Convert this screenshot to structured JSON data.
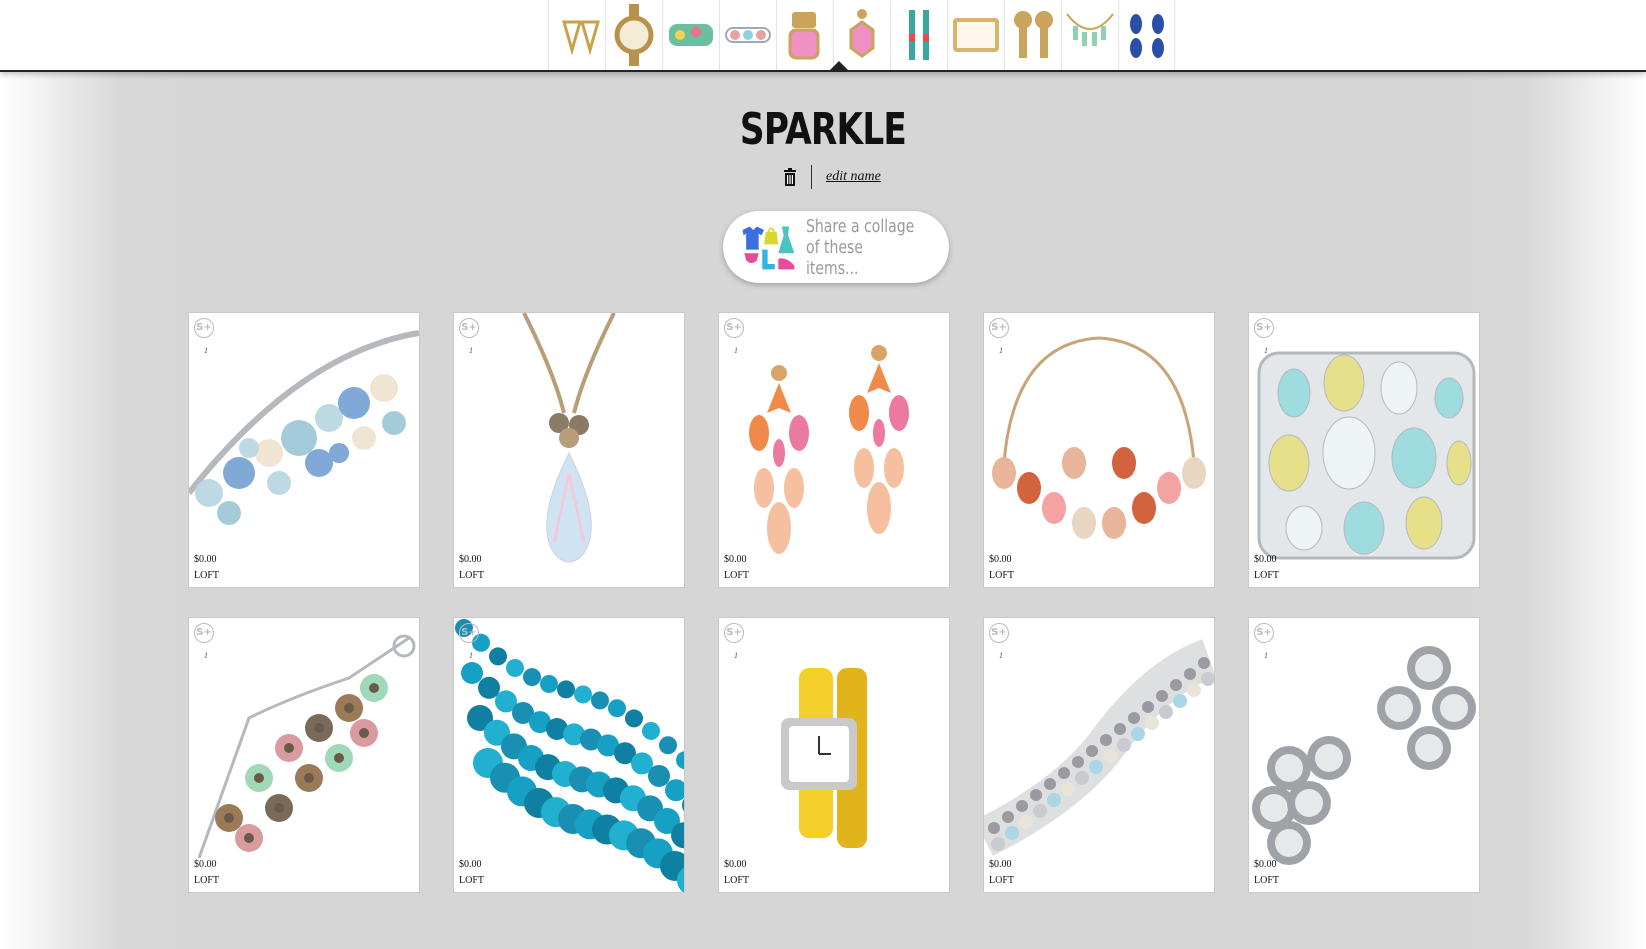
{
  "header": {
    "thumbnails": [
      {
        "name": "triangle-earrings-thumb",
        "color": "#c7a24a"
      },
      {
        "name": "gold-watch-thumb",
        "color": "#b8924a"
      },
      {
        "name": "multicolor-bracelet-thumb",
        "color": "#6bbf9f"
      },
      {
        "name": "pastel-bracelet-thumb",
        "color": "#e8a0a0"
      },
      {
        "name": "pink-stone-earrings-thumb",
        "color": "#ef8fc4"
      },
      {
        "name": "pink-octagon-earring-thumb",
        "color": "#ef8fc4"
      },
      {
        "name": "drop-earrings-thumb",
        "color": "#3aa7a1"
      },
      {
        "name": "gold-cuff-thumb",
        "color": "#d8b46a"
      },
      {
        "name": "gold-clip-earrings-thumb",
        "color": "#c9a45a"
      },
      {
        "name": "mint-necklace-thumb",
        "color": "#8fd1b0"
      },
      {
        "name": "blue-drop-earrings-thumb",
        "color": "#2b4fa8"
      }
    ]
  },
  "board": {
    "title": "SPARKLE",
    "edit_label": "edit name"
  },
  "collage": {
    "line1": "Share a collage",
    "line2": "of these items..."
  },
  "items": [
    {
      "badge": "S+",
      "count": "1",
      "price": "$0.00",
      "brand": "LOFT",
      "kind": "cluster-bracelet",
      "colors": [
        "#b9d7e3",
        "#7aa4d6",
        "#efe4d0",
        "#9fc9d6"
      ]
    },
    {
      "badge": "S+",
      "count": "1",
      "price": "$0.00",
      "brand": "LOFT",
      "kind": "pendant-necklace",
      "colors": [
        "#b89e78",
        "#8a7a66",
        "#cfe4f2",
        "#f3c9d9"
      ]
    },
    {
      "badge": "S+",
      "count": "1",
      "price": "$0.00",
      "brand": "LOFT",
      "kind": "statement-earrings",
      "colors": [
        "#f08a4b",
        "#ec7aa0",
        "#f6c0a0",
        "#d9a46a"
      ]
    },
    {
      "badge": "S+",
      "count": "1",
      "price": "$0.00",
      "brand": "LOFT",
      "kind": "bib-necklace",
      "colors": [
        "#e8b49a",
        "#d3633f",
        "#f4a2a2",
        "#e8d6c2"
      ]
    },
    {
      "badge": "S+",
      "count": "1",
      "price": "$0.00",
      "brand": "LOFT",
      "kind": "stone-cuff",
      "colors": [
        "#9fdcdf",
        "#e6e08a",
        "#eef4f6",
        "#cfe9ee"
      ]
    },
    {
      "badge": "S+",
      "count": "1",
      "price": "$0.00",
      "brand": "LOFT",
      "kind": "flower-bracelet",
      "colors": [
        "#9b7a58",
        "#9fd9b8",
        "#d99aa0",
        "#7a6a5a"
      ]
    },
    {
      "badge": "S+",
      "count": "1",
      "price": "$0.00",
      "brand": "LOFT",
      "kind": "bead-necklace",
      "colors": [
        "#1a8fb4",
        "#16a0c4",
        "#0f7fa2",
        "#22b0d0"
      ]
    },
    {
      "badge": "S+",
      "count": "1",
      "price": "$0.00",
      "brand": "LOFT",
      "kind": "wrap-watch",
      "colors": [
        "#f2cf2b",
        "#c9c9c9",
        "#ffffff",
        "#e0b41a"
      ]
    },
    {
      "badge": "S+",
      "count": "1",
      "price": "$0.00",
      "brand": "LOFT",
      "kind": "crystal-bracelet",
      "colors": [
        "#c8ccd0",
        "#aad6e6",
        "#e8e4d8",
        "#9a9aa0"
      ]
    },
    {
      "badge": "S+",
      "count": "1",
      "price": "$0.00",
      "brand": "LOFT",
      "kind": "silver-earrings",
      "colors": [
        "#c9ccd0",
        "#e6e8ea",
        "#9fa3a8",
        "#ffffff"
      ]
    }
  ]
}
